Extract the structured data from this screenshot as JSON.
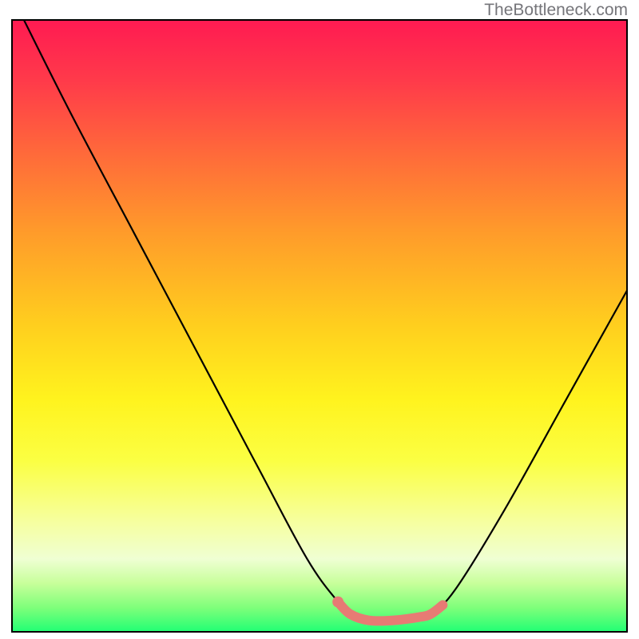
{
  "watermark": "TheBottleneck.com",
  "chart_data": {
    "type": "line",
    "title": "",
    "xlabel": "",
    "ylabel": "",
    "x_range": [
      0,
      100
    ],
    "y_range": [
      0,
      100
    ],
    "curve": {
      "description": "Bottleneck curve: high on left, descends smoothly to a flat minimum around x≈55–68, then rises toward the right",
      "points": [
        {
          "x": 2,
          "y": 100
        },
        {
          "x": 10,
          "y": 84
        },
        {
          "x": 20,
          "y": 65
        },
        {
          "x": 30,
          "y": 46
        },
        {
          "x": 40,
          "y": 27
        },
        {
          "x": 48,
          "y": 12
        },
        {
          "x": 53,
          "y": 5
        },
        {
          "x": 55,
          "y": 3
        },
        {
          "x": 58,
          "y": 2
        },
        {
          "x": 62,
          "y": 2
        },
        {
          "x": 66,
          "y": 2.5
        },
        {
          "x": 68,
          "y": 3
        },
        {
          "x": 72,
          "y": 7
        },
        {
          "x": 80,
          "y": 20
        },
        {
          "x": 90,
          "y": 38
        },
        {
          "x": 100,
          "y": 56
        }
      ]
    },
    "highlight_segment": {
      "color": "#e77b74",
      "points": [
        {
          "x": 53,
          "y": 5
        },
        {
          "x": 55,
          "y": 3
        },
        {
          "x": 58,
          "y": 2
        },
        {
          "x": 62,
          "y": 2
        },
        {
          "x": 66,
          "y": 2.5
        },
        {
          "x": 68,
          "y": 3
        },
        {
          "x": 70,
          "y": 4.5
        }
      ]
    },
    "highlight_dot": {
      "x": 53,
      "y": 5,
      "color": "#e77b74"
    },
    "background_gradient": {
      "stops": [
        {
          "pos": 0,
          "color": "#ff1a52"
        },
        {
          "pos": 0.5,
          "color": "#ffcf1e"
        },
        {
          "pos": 0.8,
          "color": "#fbff8a"
        },
        {
          "pos": 1.0,
          "color": "#1eff74"
        }
      ]
    }
  }
}
